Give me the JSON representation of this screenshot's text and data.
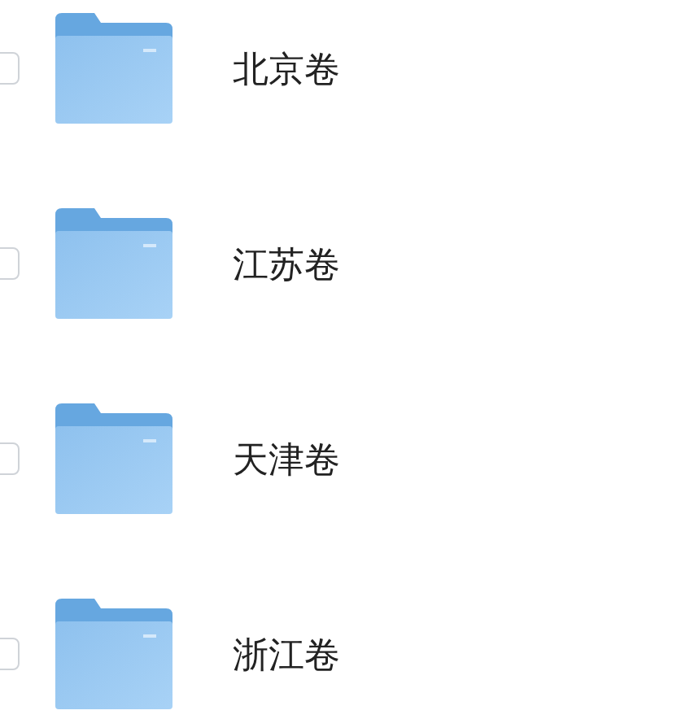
{
  "folders": [
    {
      "name": "北京卷",
      "checked": false
    },
    {
      "name": "江苏卷",
      "checked": false
    },
    {
      "name": "天津卷",
      "checked": false
    },
    {
      "name": "浙江卷",
      "checked": false
    }
  ]
}
